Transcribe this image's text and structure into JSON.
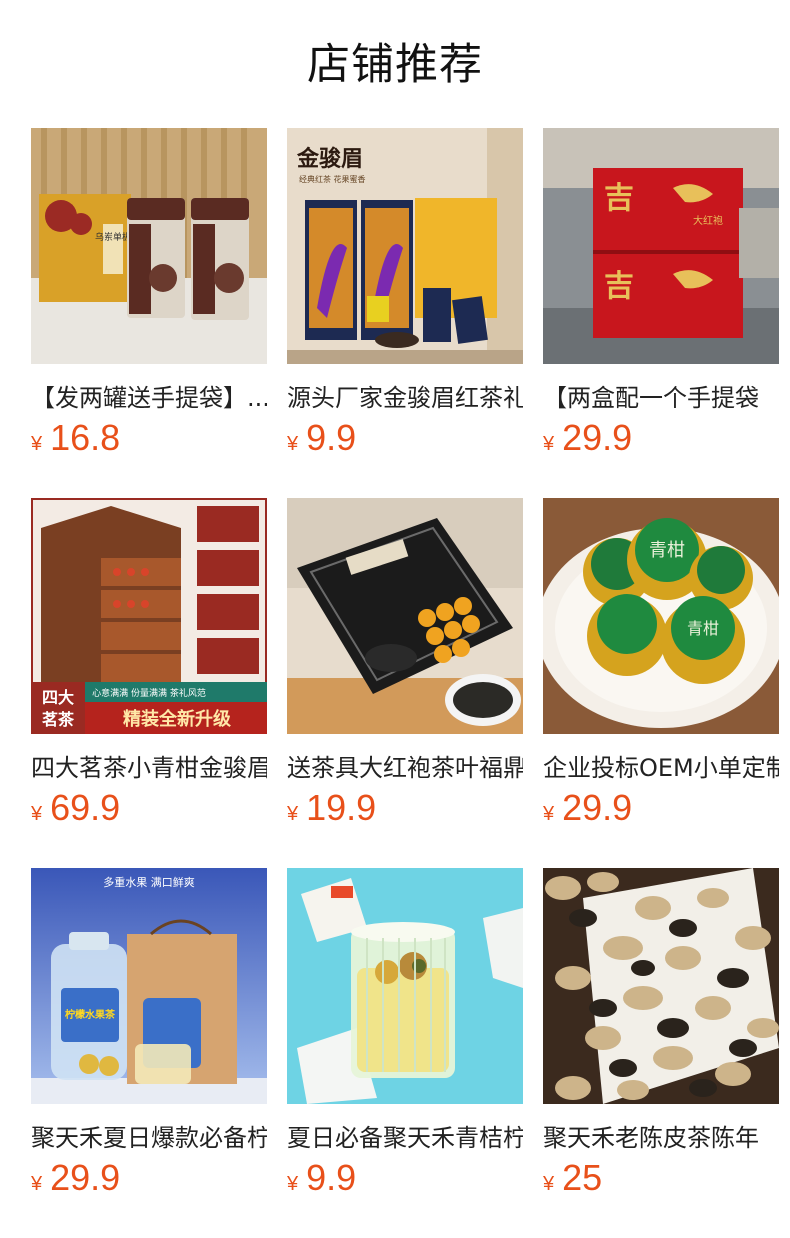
{
  "section": {
    "title": "店铺推荐"
  },
  "products": [
    {
      "name": "【发两罐送手提袋】...",
      "currency": "¥",
      "price": "16.8",
      "image": "tea-tins-with-gift-bag"
    },
    {
      "name": "源头厂家金骏眉红茶礼盒",
      "currency": "¥",
      "price": "9.9",
      "image": "jinjunmei-gift-box"
    },
    {
      "name": "【两盒配一个手提袋",
      "currency": "¥",
      "price": "29.9",
      "image": "red-dahongpao-boxes"
    },
    {
      "name": "四大茗茶小青柑金骏眉",
      "currency": "¥",
      "price": "69.9",
      "image": "wooden-drawer-tea-chest"
    },
    {
      "name": "送茶具大红袍茶叶福鼎",
      "currency": "¥",
      "price": "19.9",
      "image": "black-tea-set-box"
    },
    {
      "name": "企业投标OEM小单定制",
      "currency": "¥",
      "price": "29.9",
      "image": "green-citrus-tea-balls"
    },
    {
      "name": "聚天禾夏日爆款必备柠檬",
      "currency": "¥",
      "price": "29.9",
      "image": "lemon-fruit-tea-jar"
    },
    {
      "name": "夏日必备聚天禾青桔柠檬",
      "currency": "¥",
      "price": "9.9",
      "image": "iced-citrus-tea-glass"
    },
    {
      "name": "聚天禾老陈皮茶陈年",
      "currency": "¥",
      "price": "25",
      "image": "dried-tangerine-peel"
    }
  ],
  "image_labels": {
    "p1_tin": "乌岽单枞",
    "p2_brand": "金骏眉",
    "p2_sub": "经典红茶 花果蜜香",
    "p3_brand": "吉",
    "p3_sub": "大红袍",
    "p4_badge_line1": "四大",
    "p4_badge_line2": "茗茶",
    "p4_banner": "精装全新升级",
    "p4_caption": "心意满满 份量满满 茶礼风范",
    "p6_label": "青柑",
    "p7_headline": "多重水果 满口鲜爽",
    "p7_jar": "柠檬水果茶"
  },
  "colors": {
    "price": "#e8501a",
    "title": "#111111",
    "name": "#222222"
  }
}
